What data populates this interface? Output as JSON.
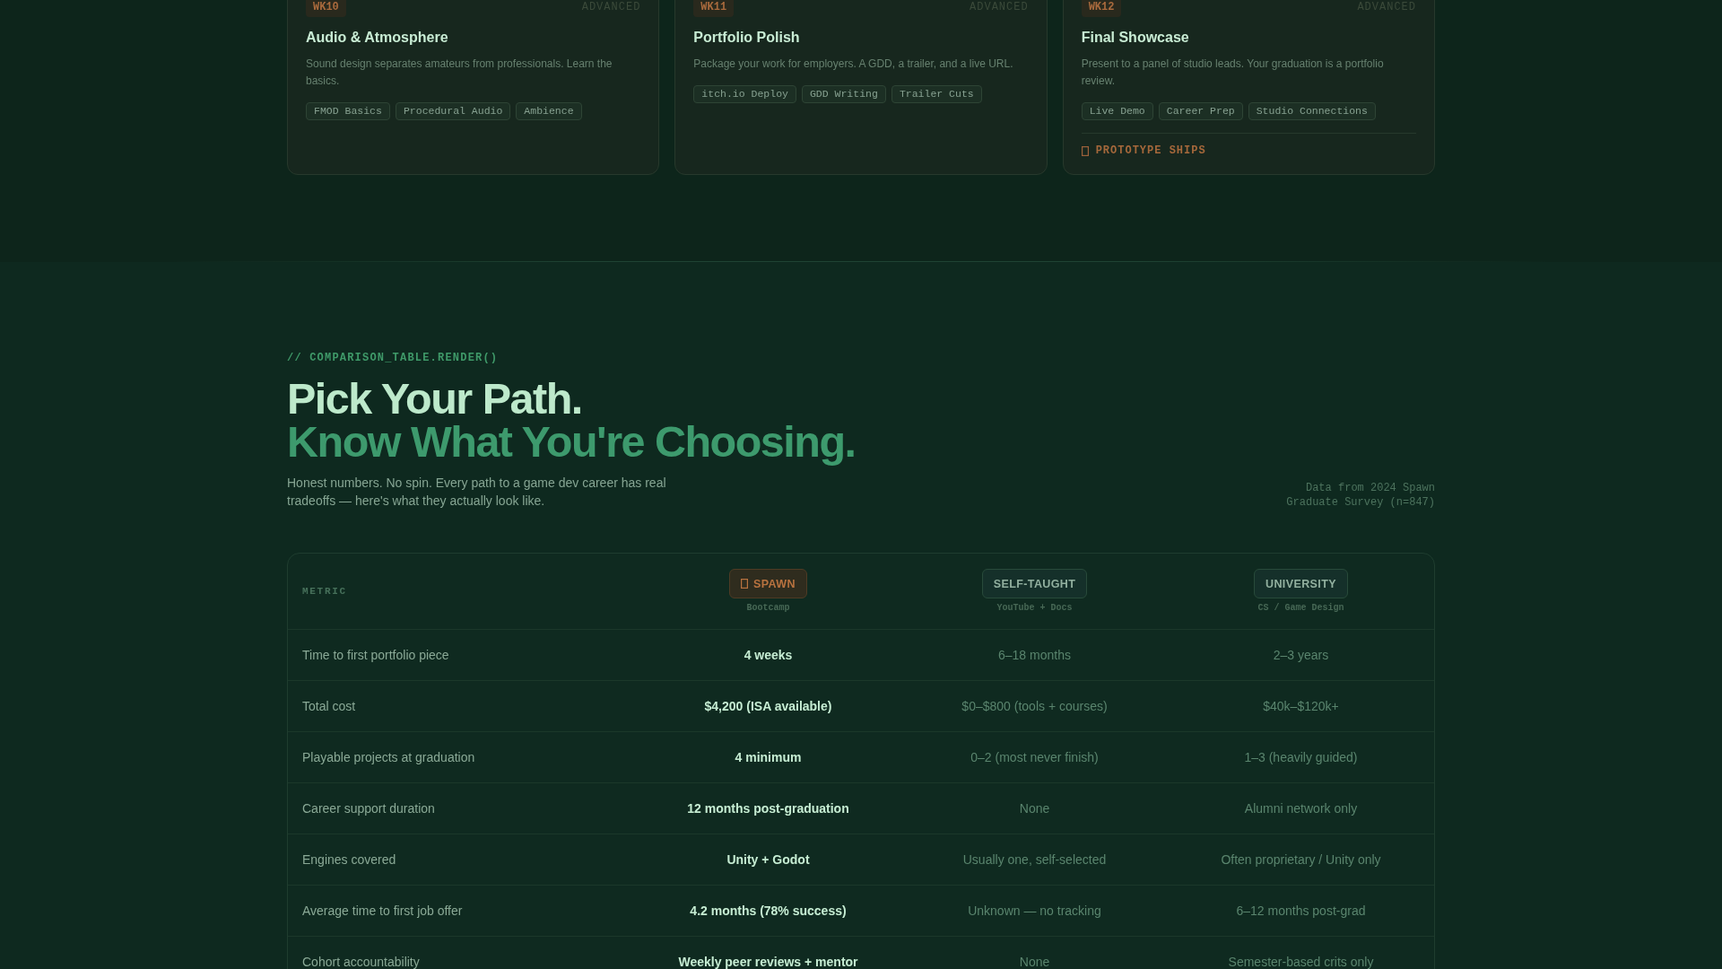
{
  "course_cards": [
    {
      "week": "WK10",
      "difficulty": "ADVANCED",
      "title": "Audio & Atmosphere",
      "description": "Sound design separates amateurs from professionals. Learn the basics.",
      "tags": [
        "FMOD Basics",
        "Procedural Audio",
        "Ambience"
      ]
    },
    {
      "week": "WK11",
      "difficulty": "ADVANCED",
      "title": "Portfolio Polish",
      "description": "Package your work for employers. A GDD, a trailer, and a live URL.",
      "tags": [
        "itch.io Deploy",
        "GDD Writing",
        "Trailer Cuts"
      ]
    },
    {
      "week": "WK12",
      "difficulty": "ADVANCED",
      "title": "Final Showcase",
      "description": "Present to a panel of studio leads. Your graduation is a portfolio review.",
      "tags": [
        "Live Demo",
        "Career Prep",
        "Studio Connections"
      ],
      "milestone": "PROTOTYPE SHIPS"
    }
  ],
  "comparison": {
    "eyebrow": "// COMPARISON_TABLE.RENDER()",
    "title": "Pick Your Path.",
    "subtitle": "Know What You're Choosing.",
    "description": "Honest numbers. No spin. Every path to a game dev career has real tradeoffs — here's what they actually look like.",
    "source_note": "Data from 2024 Spawn Graduate Survey (n=847)",
    "table": {
      "columns": [
        {
          "kind": "metric",
          "label": "METRIC"
        },
        {
          "kind": "option",
          "label": "SPAWN",
          "sublabel": "Bootcamp",
          "featured": true
        },
        {
          "kind": "option",
          "label": "SELF-TAUGHT",
          "sublabel": "YouTube + Docs",
          "featured": false
        },
        {
          "kind": "option",
          "label": "UNIVERSITY",
          "sublabel": "CS / Game Design",
          "featured": false
        }
      ],
      "rows": [
        {
          "metric": "Time to first portfolio piece",
          "values": [
            "4 weeks",
            "6–18 months",
            "2–3 years"
          ]
        },
        {
          "metric": "Total cost",
          "values": [
            "$4,200 (ISA available)",
            "$0–$800 (tools + courses)",
            "$40k–$120k+"
          ]
        },
        {
          "metric": "Playable projects at graduation",
          "values": [
            "4 minimum",
            "0–2 (most never finish)",
            "1–3 (heavily guided)"
          ]
        },
        {
          "metric": "Career support duration",
          "values": [
            "12 months post-graduation",
            "None",
            "Alumni network only"
          ]
        },
        {
          "metric": "Engines covered",
          "values": [
            "Unity + Godot",
            "Usually one, self-selected",
            "Often proprietary / Unity only"
          ]
        },
        {
          "metric": "Average time to first job offer",
          "values": [
            "4.2 months (78% success)",
            "Unknown — no tracking",
            "6–12 months post-grad"
          ]
        },
        {
          "metric": "Cohort accountability",
          "values": [
            "Weekly peer reviews + mentor",
            "None",
            "Semester-based crits only"
          ]
        }
      ]
    }
  }
}
